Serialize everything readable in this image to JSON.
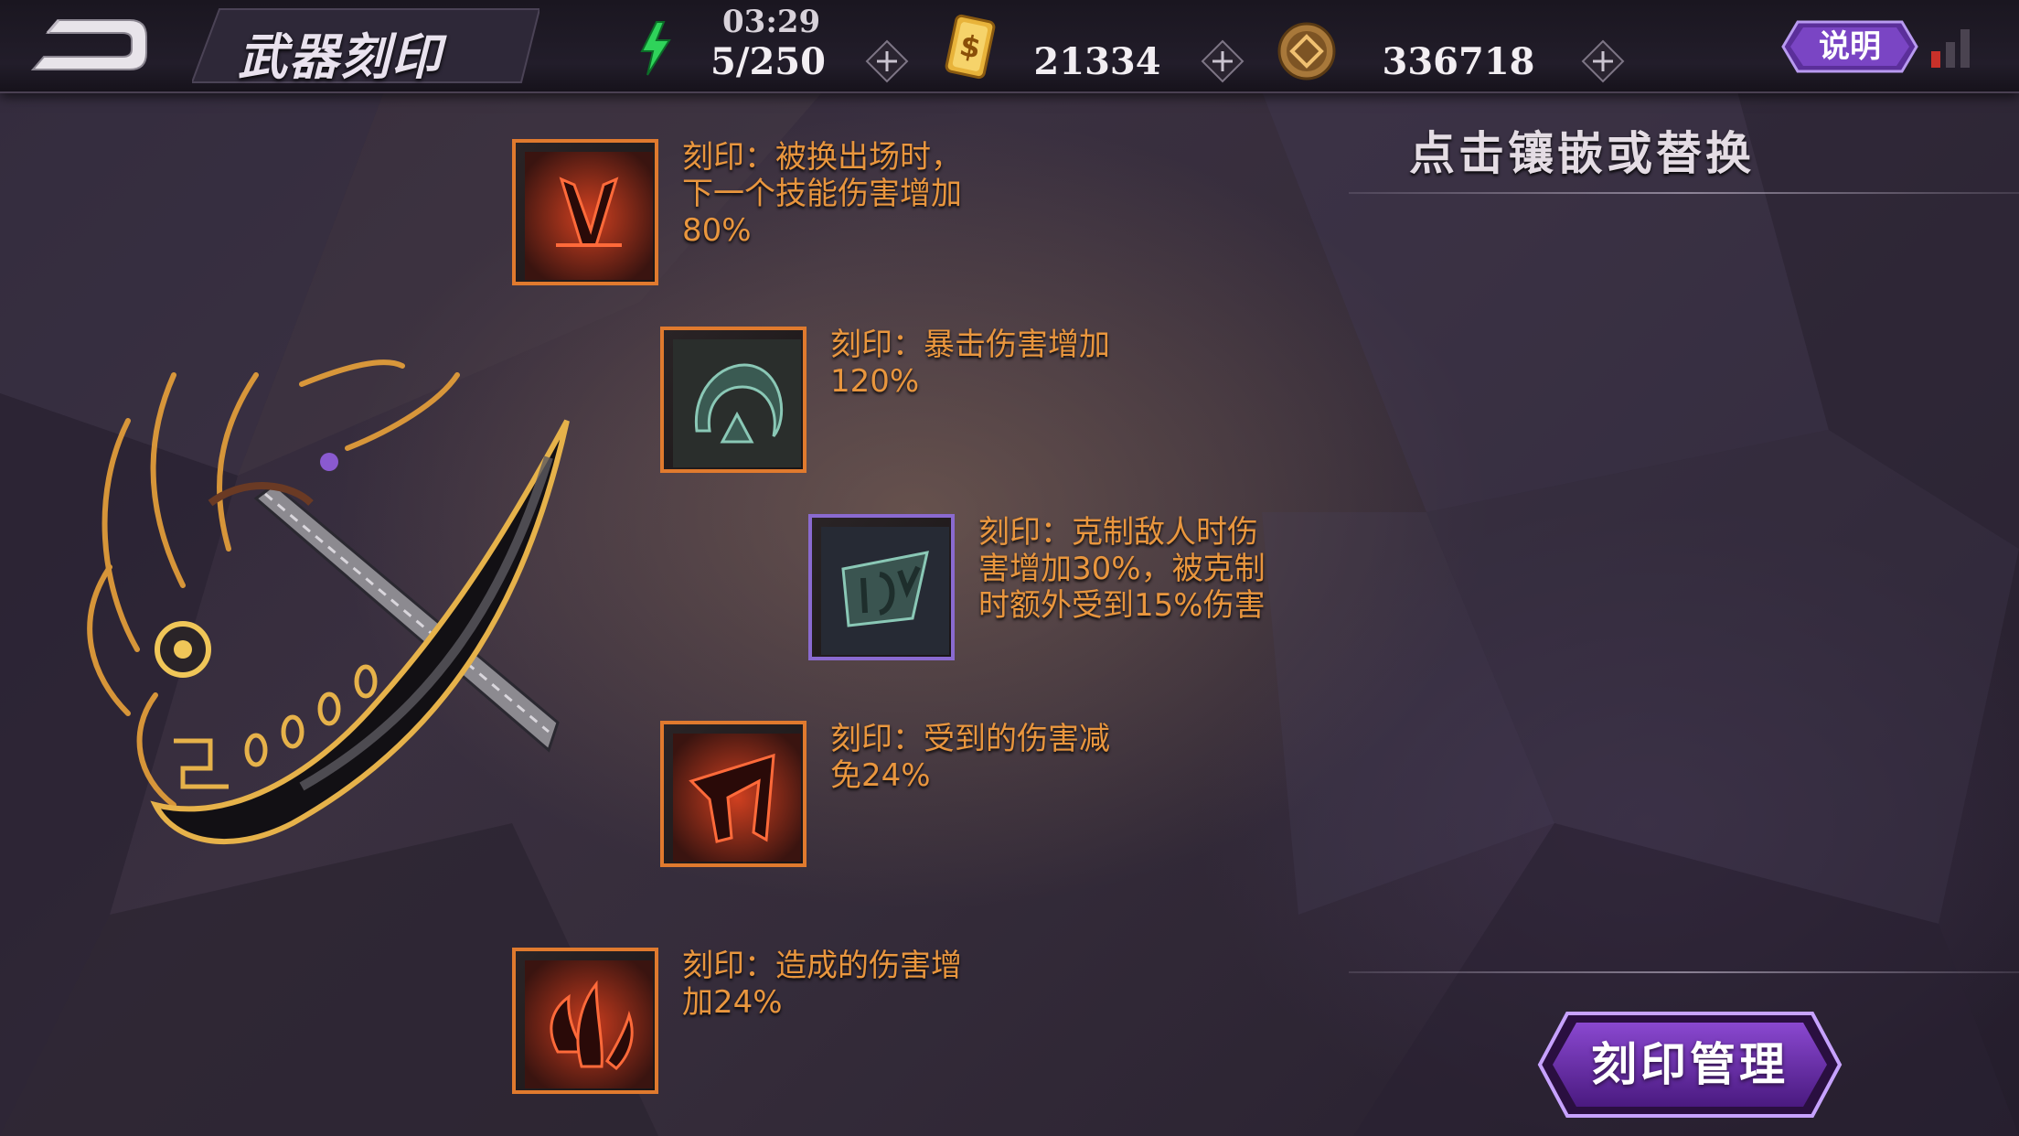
{
  "header": {
    "title": "武器刻印",
    "clock": "03:29",
    "energy": "5/250",
    "coins": "21334",
    "tokens": "336718",
    "help_label": "说明"
  },
  "slots": [
    {
      "rarity": "orange",
      "icon": "red-horns-rune-icon",
      "text": "刻印：被换出场时，\n下一个技能伤害增加\n80%"
    },
    {
      "rarity": "orange",
      "icon": "teal-crescent-rune-icon",
      "text": "刻印：暴击伤害增加\n120%"
    },
    {
      "rarity": "purple",
      "icon": "teal-shield-rune-icon",
      "text": "刻印：克制敌人时伤\n害增加30%，被克制\n时额外受到15%伤害"
    },
    {
      "rarity": "orange",
      "icon": "red-claw-rune-icon",
      "text": "刻印：受到的伤害减\n免24%"
    },
    {
      "rarity": "orange",
      "icon": "red-flame-rune-icon",
      "text": "刻印：造成的伤害增\n加24%"
    }
  ],
  "panel": {
    "hint": "点击镶嵌或替换",
    "manage_label": "刻印管理"
  },
  "colors": {
    "slot_orange_border": "#e07a2e",
    "slot_purple_border": "#8a6ad0",
    "desc_text": "#e9963e",
    "energy_green": "#2fd35a",
    "coin_gold": "#e8b33a",
    "manage_purple": "#6a2aa8"
  }
}
